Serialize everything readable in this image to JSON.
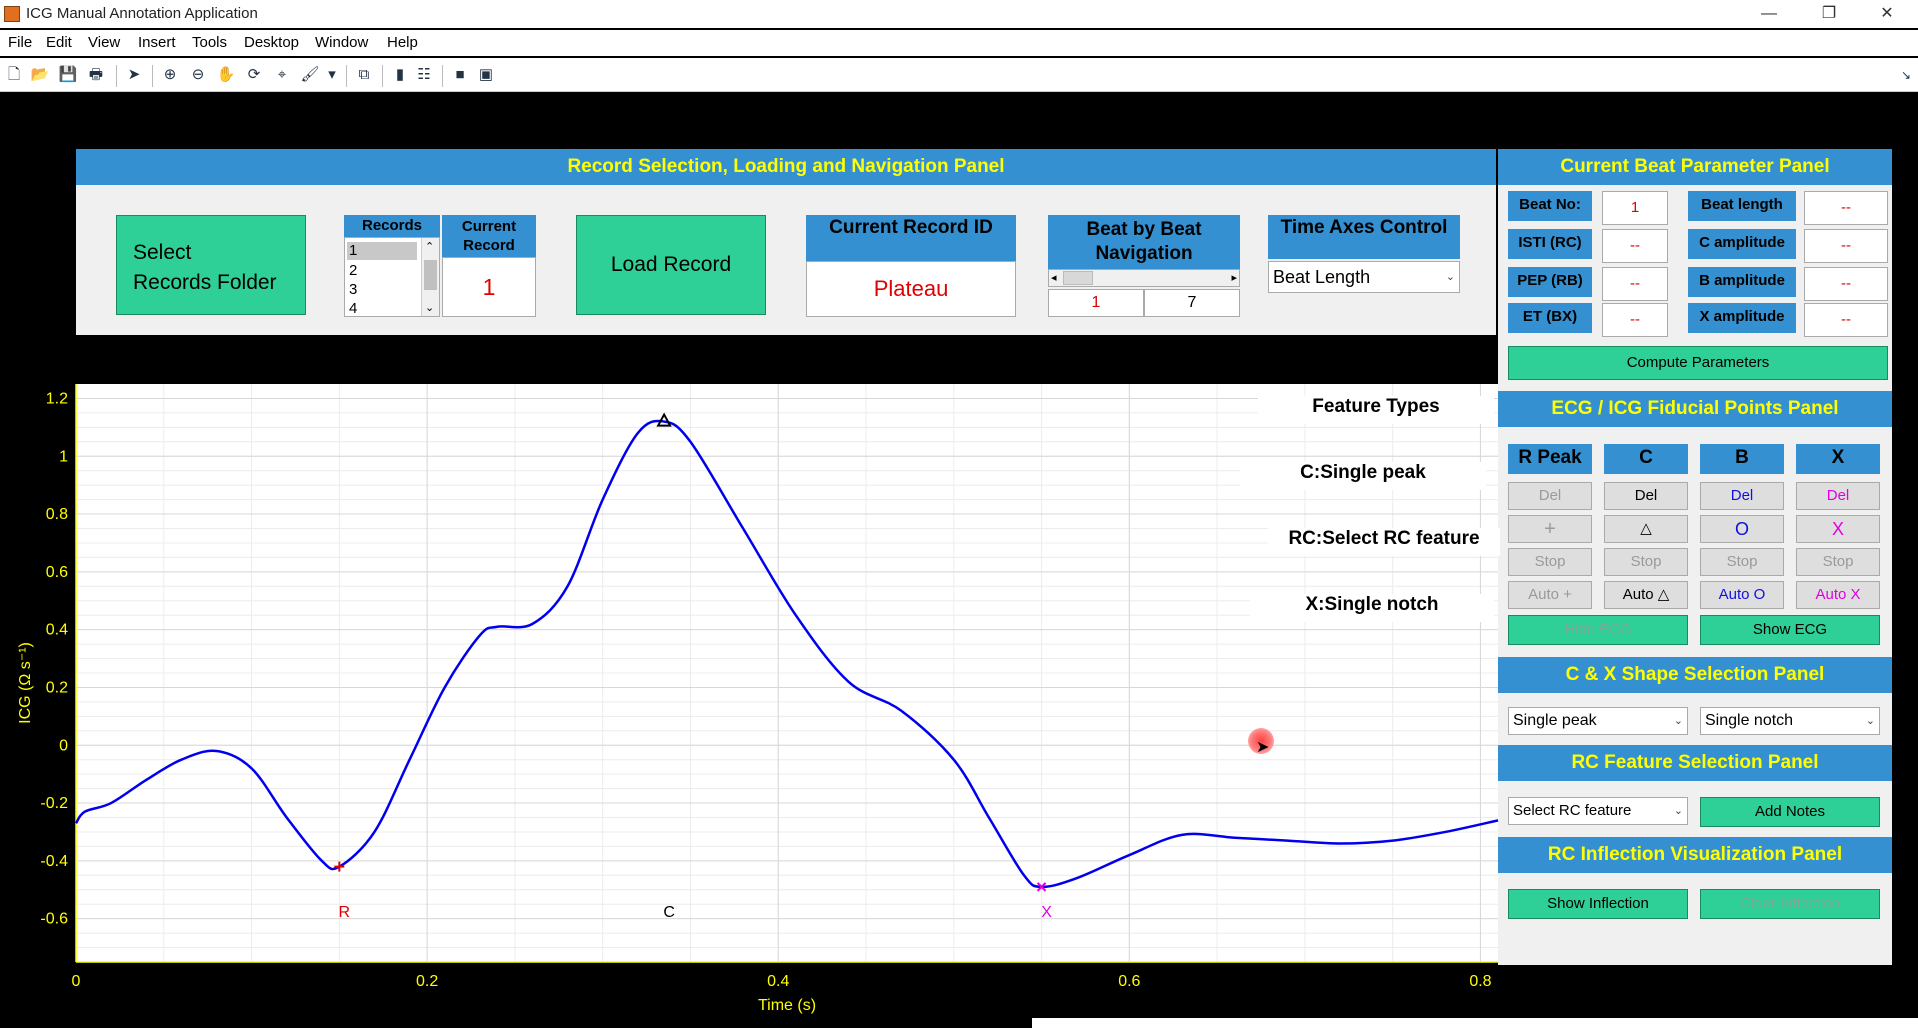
{
  "window": {
    "title": "ICG Manual Annotation Application",
    "minimize": "—",
    "restore": "❐",
    "close": "✕"
  },
  "menu": [
    "File",
    "Edit",
    "View",
    "Insert",
    "Tools",
    "Desktop",
    "Window",
    "Help"
  ],
  "record_panel": {
    "title": "Record Selection, Loading and Navigation Panel",
    "select_folder_line1": "Select",
    "select_folder_line2": "Records Folder",
    "records_header": "Records",
    "records_list": [
      "1",
      "2",
      "3",
      "4"
    ],
    "current_record_header_1": "Current",
    "current_record_header_2": "Record",
    "current_record_value": "1",
    "load_record": "Load Record",
    "current_record_id_header": "Current Record ID",
    "current_record_id_value": "Plateau",
    "beat_nav_header_1": "Beat by Beat",
    "beat_nav_header_2": "Navigation",
    "beat_nav_current": "1",
    "beat_nav_total": "7",
    "time_axes_header": "Time Axes Control",
    "time_axes_value": "Beat Length"
  },
  "beat_param_panel": {
    "title": "Current Beat Parameter Panel",
    "rows": [
      {
        "label_a": "Beat No:",
        "value_a": "1",
        "label_b": "Beat length",
        "value_b": "--"
      },
      {
        "label_a": "ISTI (RC)",
        "value_a": "--",
        "label_b": "C amplitude",
        "value_b": "--"
      },
      {
        "label_a": "PEP (RB)",
        "value_a": "--",
        "label_b": "B amplitude",
        "value_b": "--"
      },
      {
        "label_a": "ET (BX)",
        "value_a": "--",
        "label_b": "X amplitude",
        "value_b": "--"
      }
    ],
    "compute_button": "Compute Parameters"
  },
  "fiducial_panel": {
    "title": "ECG / ICG Fiducial Points Panel",
    "columns": [
      {
        "header": "R Peak",
        "del": "Del",
        "add": "+",
        "stop": "Stop",
        "auto": "Auto +",
        "color": "#9a9a9a"
      },
      {
        "header": "C",
        "del": "Del",
        "add": "△",
        "stop": "Stop",
        "auto": "Auto △",
        "color": "#000000"
      },
      {
        "header": "B",
        "del": "Del",
        "add": "O",
        "stop": "Stop",
        "auto": "Auto O",
        "color": "#1010e0"
      },
      {
        "header": "X",
        "del": "Del",
        "add": "X",
        "stop": "Stop",
        "auto": "Auto X",
        "color": "#e000e0"
      }
    ],
    "hide_ecg": "Hide ECG",
    "show_ecg": "Show ECG"
  },
  "shape_panel": {
    "title": "C & X Shape Selection Panel",
    "c_shape": "Single peak",
    "x_shape": "Single notch"
  },
  "rc_feature_panel": {
    "title": "RC Feature Selection Panel",
    "rc_feature": "Select RC feature",
    "add_notes": "Add Notes"
  },
  "rc_inflection_panel": {
    "title": "RC Inflection Visualization Panel",
    "show": "Show Inflection",
    "clear": "Clear Inflection"
  },
  "feature_types": {
    "header": "Feature Types",
    "c": "C:Single peak",
    "rc": "RC:Select RC feature",
    "x": "X:Single notch"
  },
  "marker_labels": {
    "r": "R",
    "c": "C",
    "x": "X"
  },
  "chart_data": {
    "type": "line",
    "xlabel": "Time (s)",
    "ylabel": "ICG (Ω s⁻¹)",
    "xlim": [
      0,
      0.81
    ],
    "ylim": [
      -0.75,
      1.25
    ],
    "xticks": [
      0,
      0.2,
      0.4,
      0.6,
      0.8
    ],
    "xtick_labels": [
      "0",
      "0.2",
      "0.4",
      "0.6",
      "0.8"
    ],
    "yticks": [
      -0.6,
      -0.4,
      -0.2,
      0,
      0.2,
      0.4,
      0.6,
      0.8,
      1.0,
      1.2
    ],
    "ytick_labels": [
      "-0.6",
      "-0.4",
      "-0.2",
      "0",
      "0.2",
      "0.4",
      "0.6",
      "0.8",
      "1",
      "1.2"
    ],
    "grid": true,
    "series": [
      {
        "color": "#0000ee",
        "x": [
          0,
          0.005,
          0.02,
          0.04,
          0.06,
          0.08,
          0.1,
          0.12,
          0.14,
          0.15,
          0.17,
          0.19,
          0.21,
          0.23,
          0.24,
          0.26,
          0.28,
          0.3,
          0.32,
          0.335,
          0.35,
          0.38,
          0.41,
          0.44,
          0.47,
          0.5,
          0.52,
          0.54,
          0.55,
          0.57,
          0.6,
          0.63,
          0.66,
          0.69,
          0.72,
          0.75,
          0.78,
          0.81
        ],
        "y": [
          -0.27,
          -0.23,
          -0.2,
          -0.12,
          -0.05,
          -0.02,
          -0.08,
          -0.25,
          -0.4,
          -0.42,
          -0.3,
          -0.05,
          0.2,
          0.38,
          0.41,
          0.42,
          0.55,
          0.85,
          1.08,
          1.12,
          1.05,
          0.75,
          0.45,
          0.22,
          0.12,
          -0.05,
          -0.25,
          -0.45,
          -0.49,
          -0.46,
          -0.38,
          -0.31,
          -0.32,
          -0.33,
          -0.34,
          -0.33,
          -0.3,
          -0.26
        ]
      }
    ],
    "markers": [
      {
        "label": "R",
        "x": 0.15,
        "y": -0.42,
        "color": "#e00000",
        "symbol": "+"
      },
      {
        "label": "C",
        "x": 0.335,
        "y": 1.12,
        "color": "#000000",
        "symbol": "triangle"
      },
      {
        "label": "X",
        "x": 0.55,
        "y": -0.49,
        "color": "#e000e0",
        "symbol": "x"
      }
    ]
  },
  "colors": {
    "panel_blue": "#3490d0",
    "title_yellow": "#ffff00",
    "button_green": "#2fcf98",
    "value_red": "#e00000"
  }
}
